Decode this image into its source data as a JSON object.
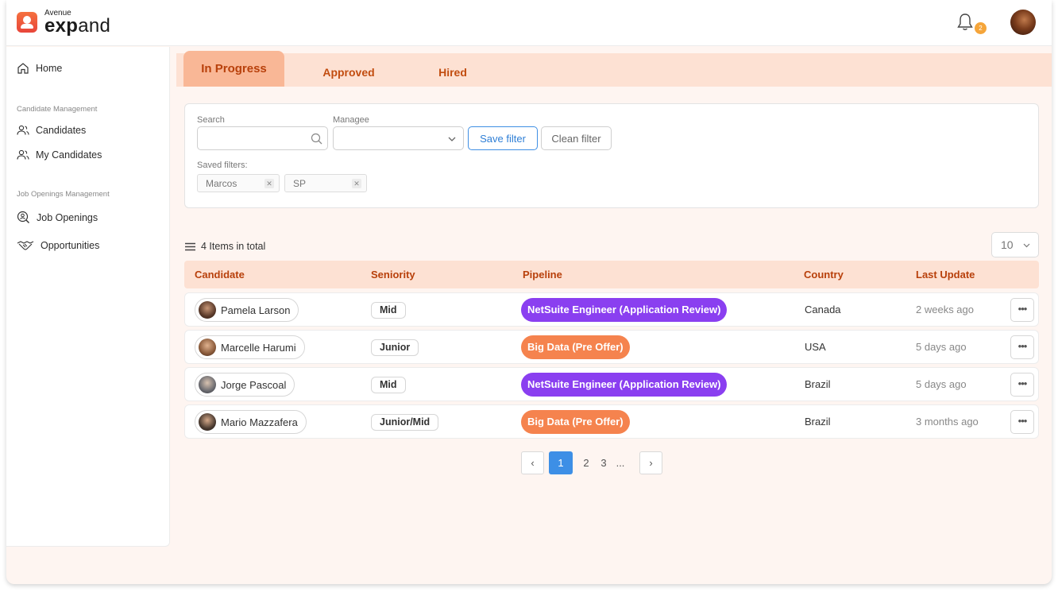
{
  "brand": {
    "top": "Avenue",
    "bottom_bold": "exp",
    "bottom_rest": "and"
  },
  "notifications": {
    "count": "2"
  },
  "sidebar": {
    "home": "Home",
    "section_candidates": "Candidate Management",
    "candidates": "Candidates",
    "my_candidates": "My Candidates",
    "section_jobs": "Job Openings Management",
    "job_openings": "Job Openings",
    "opportunities": "Opportunities"
  },
  "tabs": [
    {
      "label": "In Progress",
      "active": true
    },
    {
      "label": "Approved",
      "active": false
    },
    {
      "label": "Hired",
      "active": false
    }
  ],
  "filters": {
    "search_label": "Search",
    "search_value": "",
    "managee_label": "Managee",
    "managee_value": "",
    "save_label": "Save filter",
    "clean_label": "Clean filter",
    "saved_label": "Saved filters:",
    "saved": [
      "Marcos",
      "SP"
    ]
  },
  "list": {
    "total": "4 Items in total",
    "page_size": "10",
    "columns": [
      "Candidate",
      "Seniority",
      "Pipeline",
      "Country",
      "Last Update"
    ],
    "rows": [
      {
        "name": "Pamela Larson",
        "seniority": "Mid",
        "pipeline": "NetSuite Engineer (Application Review)",
        "pipeline_color": "#8a3ff0",
        "country": "Canada",
        "updated": "2 weeks ago",
        "avatar_color": "#5a3a2a"
      },
      {
        "name": "Marcelle Harumi",
        "seniority": "Junior",
        "pipeline": "Big Data (Pre Offer)",
        "pipeline_color": "#f5834e",
        "country": "USA",
        "updated": "5 days ago",
        "avatar_color": "#8a5a3a"
      },
      {
        "name": "Jorge Pascoal",
        "seniority": "Mid",
        "pipeline": "NetSuite Engineer (Application Review)",
        "pipeline_color": "#8a3ff0",
        "country": "Brazil",
        "updated": "5 days ago",
        "avatar_color": "#6b6b70"
      },
      {
        "name": "Mario Mazzafera",
        "seniority": "Junior/Mid",
        "pipeline": "Big Data (Pre Offer)",
        "pipeline_color": "#f5834e",
        "country": "Brazil",
        "updated": "3 months ago",
        "avatar_color": "#4a3a30"
      }
    ]
  },
  "pagination": {
    "prev": "‹",
    "current": "1",
    "pages": [
      "2",
      "3",
      "..."
    ],
    "next": "›"
  },
  "colors": {
    "accent": "#f5834e",
    "tab_bg": "#fde1d3",
    "primary_blue": "#3d8fe6",
    "purple": "#8a3ff0"
  }
}
